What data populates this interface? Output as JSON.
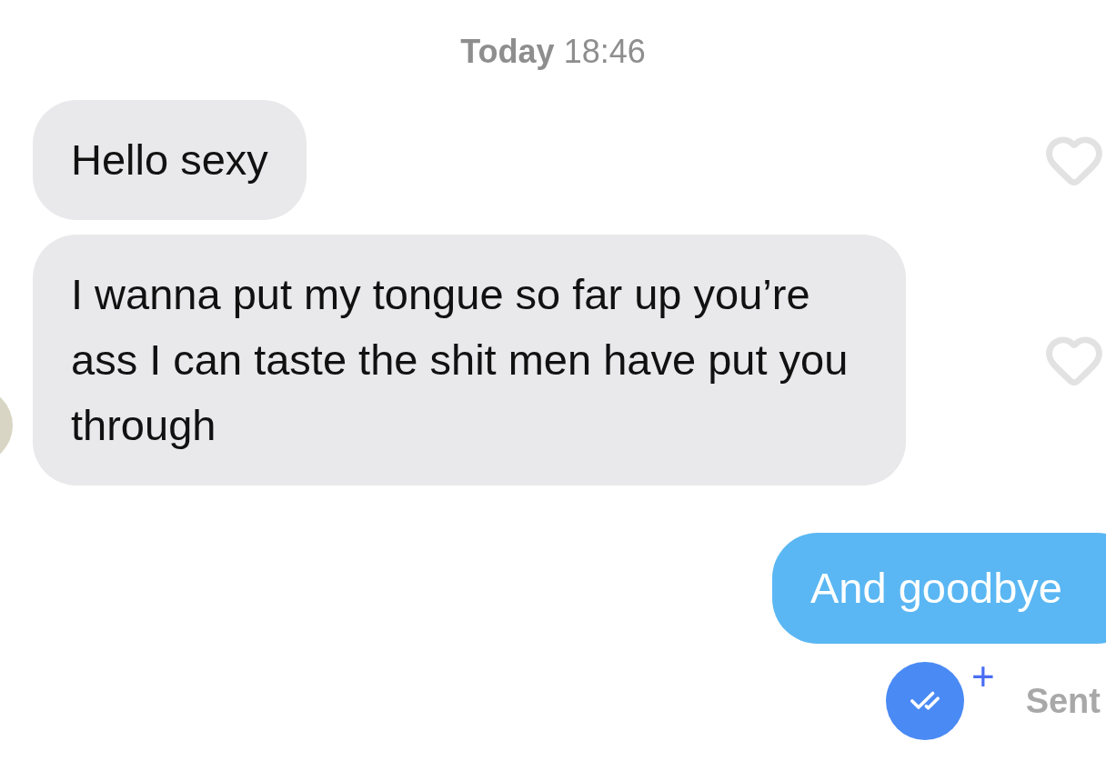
{
  "date_header": {
    "day": "Today",
    "time": "18:46"
  },
  "messages": [
    {
      "kind": "received",
      "text": "Hello sexy",
      "liked": false,
      "avatar": false
    },
    {
      "kind": "received",
      "text": "I wanna put my tongue so far up you’re ass I can taste the shit men have put you through",
      "liked": false,
      "avatar": true
    },
    {
      "kind": "sent",
      "text": "And goodbye"
    }
  ],
  "receipt": {
    "status": "Sent",
    "plus": "+"
  }
}
